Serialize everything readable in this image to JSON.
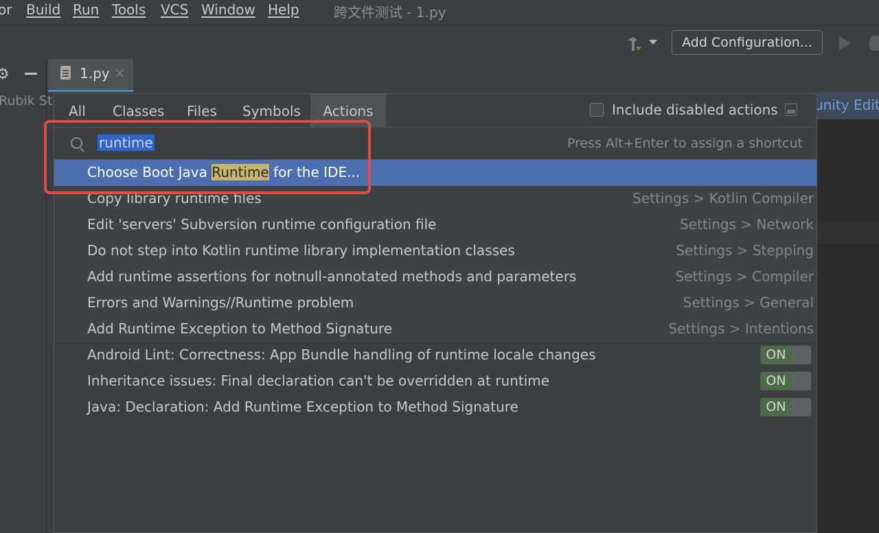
{
  "menubar": {
    "items": [
      "or",
      "Build",
      "Run",
      "Tools",
      "VCS",
      "Window",
      "Help"
    ],
    "window_title": "跨文件测试 - 1.py"
  },
  "toolbar": {
    "add_configuration": "Add Configuration..."
  },
  "project": {
    "label": "Rubik St"
  },
  "editor": {
    "tab_label": "1.py",
    "tab_close": "×",
    "banner_text": "unity Editi"
  },
  "popup": {
    "tabs": [
      "All",
      "Classes",
      "Files",
      "Symbols",
      "Actions"
    ],
    "active_tab": "Actions",
    "include_disabled_label": "Include disabled actions",
    "search_value": "runtime",
    "search_hint": "Press Alt+Enter to assign a shortcut",
    "selected_result": {
      "prefix": "Choose Boot Java ",
      "highlight": "Runtime",
      "suffix": " for the IDE..."
    },
    "settings_results": [
      {
        "text": "Copy library runtime files",
        "path": "Settings > Kotlin Compiler"
      },
      {
        "text": "Edit 'servers' Subversion runtime configuration file",
        "path": "Settings > Network"
      },
      {
        "text": "Do not step into Kotlin runtime library implementation classes",
        "path": "Settings > Stepping"
      },
      {
        "text": "Add runtime assertions for notnull-annotated methods and parameters",
        "path": "Settings > Compiler"
      },
      {
        "text": "Errors and Warnings//Runtime problem",
        "path": "Settings > General"
      },
      {
        "text": "Add Runtime Exception to Method Signature",
        "path": "Settings > Intentions"
      }
    ],
    "inspection_results": [
      {
        "text": "Android Lint: Correctness: App Bundle handling of runtime locale changes",
        "toggle": "ON"
      },
      {
        "text": "Inheritance issues: Final declaration can't be overridden at runtime",
        "toggle": "ON"
      },
      {
        "text": "Java: Declaration: Add Runtime Exception to Method Signature",
        "toggle": "ON"
      }
    ]
  },
  "colors": {
    "selection": "#4b6eaf",
    "match_highlight": "#c6b56a",
    "annotation": "#e04b44",
    "toggle_on": "#4e6b49"
  }
}
